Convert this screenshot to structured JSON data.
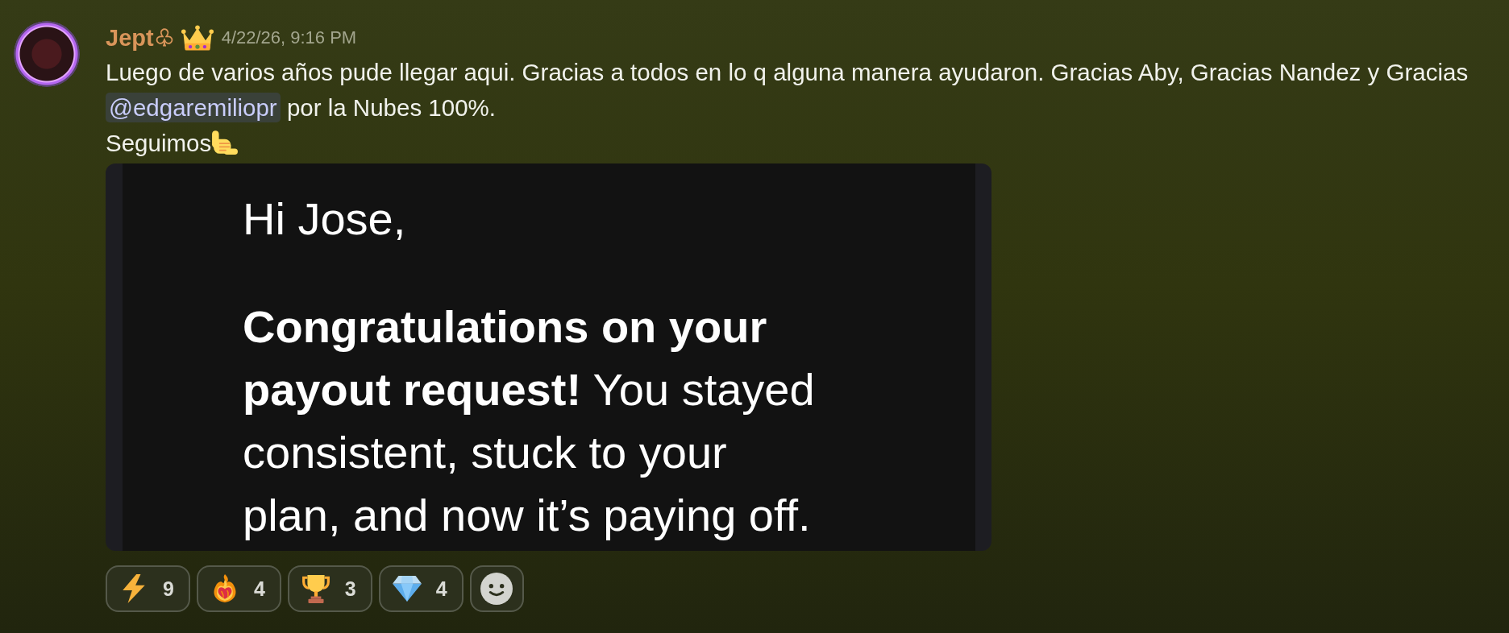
{
  "message": {
    "author": "Jept♧",
    "timestamp": "4/22/26, 9:16 PM",
    "content": [
      [
        {
          "kind": "text",
          "text": "Luego de varios años pude llegar aqui. Gracias a todos en lo q alguna manera ayudaron. Gracias Aby, Gracias Nandez y Gracias "
        },
        {
          "kind": "mention",
          "text": "@edgaremiliopr"
        },
        {
          "kind": "text",
          "text": " por la Nubes 100%."
        }
      ],
      [
        {
          "kind": "text",
          "text": "Seguimos"
        },
        {
          "kind": "emoji"
        }
      ]
    ]
  },
  "email": {
    "greeting": "Hi Jose,",
    "body": "**Congratulations on your payout request!** You stayed consistent, stuck to your plan, and now it’s paying off."
  },
  "reactions": [
    {
      "kind": "bolt",
      "count": "9",
      "selected": false
    },
    {
      "kind": "heart",
      "count": "4",
      "selected": false
    },
    {
      "kind": "trophy",
      "count": "3",
      "selected": false
    },
    {
      "kind": "gem",
      "count": "4",
      "selected": false
    }
  ]
}
